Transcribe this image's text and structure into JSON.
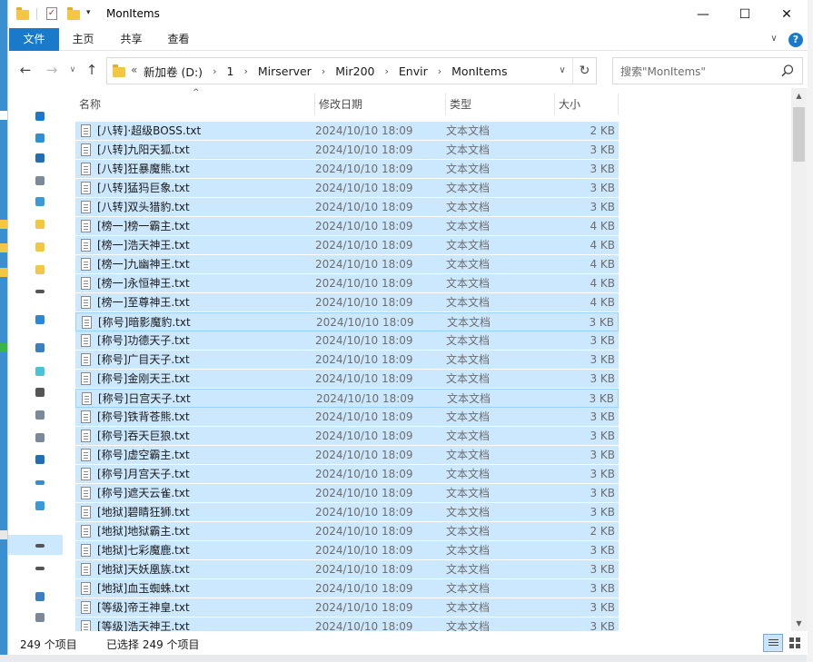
{
  "window": {
    "title": "MonItems",
    "minimize_glyph": "—",
    "maximize_glyph": "☐",
    "close_glyph": "✕"
  },
  "qat": {
    "dropdown_glyph": "▾"
  },
  "ribbon": {
    "tabs": [
      {
        "label": "文件"
      },
      {
        "label": "主页"
      },
      {
        "label": "共享"
      },
      {
        "label": "查看"
      }
    ],
    "expand_glyph": "∨",
    "help_glyph": "?"
  },
  "nav": {
    "back_glyph": "←",
    "forward_glyph": "→",
    "recent_glyph": "∨",
    "up_glyph": "↑"
  },
  "address": {
    "overflow_glyph": "«",
    "separator_glyph": "›",
    "crumbs": [
      "新加卷 (D:)",
      "1",
      "Mirserver",
      "Mir200",
      "Envir",
      "MonItems"
    ],
    "dropdown_glyph": "∨",
    "refresh_glyph": "↻"
  },
  "search": {
    "placeholder": "搜索\"MonItems\""
  },
  "columns": {
    "sort_glyph": "^",
    "name": "名称",
    "date": "修改日期",
    "type": "类型",
    "size": "大小"
  },
  "files": [
    {
      "name": "[八转]·超级BOSS.txt",
      "date": "2024/10/10 18:09",
      "type": "文本文档",
      "size": "2 KB"
    },
    {
      "name": "[八转]九阳天狐.txt",
      "date": "2024/10/10 18:09",
      "type": "文本文档",
      "size": "3 KB"
    },
    {
      "name": "[八转]狂暴魔熊.txt",
      "date": "2024/10/10 18:09",
      "type": "文本文档",
      "size": "3 KB"
    },
    {
      "name": "[八转]猛犸巨象.txt",
      "date": "2024/10/10 18:09",
      "type": "文本文档",
      "size": "3 KB"
    },
    {
      "name": "[八转]双头猎豹.txt",
      "date": "2024/10/10 18:09",
      "type": "文本文档",
      "size": "3 KB"
    },
    {
      "name": "[榜一]榜一霸主.txt",
      "date": "2024/10/10 18:09",
      "type": "文本文档",
      "size": "4 KB"
    },
    {
      "name": "[榜一]浩天神王.txt",
      "date": "2024/10/10 18:09",
      "type": "文本文档",
      "size": "4 KB"
    },
    {
      "name": "[榜一]九幽神王.txt",
      "date": "2024/10/10 18:09",
      "type": "文本文档",
      "size": "4 KB"
    },
    {
      "name": "[榜一]永恒神王.txt",
      "date": "2024/10/10 18:09",
      "type": "文本文档",
      "size": "4 KB"
    },
    {
      "name": "[榜一]至尊神王.txt",
      "date": "2024/10/10 18:09",
      "type": "文本文档",
      "size": "4 KB"
    },
    {
      "name": "[称号]暗影魔豹.txt",
      "date": "2024/10/10 18:09",
      "type": "文本文档",
      "size": "3 KB"
    },
    {
      "name": "[称号]功德天子.txt",
      "date": "2024/10/10 18:09",
      "type": "文本文档",
      "size": "3 KB"
    },
    {
      "name": "[称号]广目天子.txt",
      "date": "2024/10/10 18:09",
      "type": "文本文档",
      "size": "3 KB"
    },
    {
      "name": "[称号]金刚天王.txt",
      "date": "2024/10/10 18:09",
      "type": "文本文档",
      "size": "3 KB"
    },
    {
      "name": "[称号]日宫天子.txt",
      "date": "2024/10/10 18:09",
      "type": "文本文档",
      "size": "3 KB"
    },
    {
      "name": "[称号]铁背苍熊.txt",
      "date": "2024/10/10 18:09",
      "type": "文本文档",
      "size": "3 KB"
    },
    {
      "name": "[称号]吞天巨狼.txt",
      "date": "2024/10/10 18:09",
      "type": "文本文档",
      "size": "3 KB"
    },
    {
      "name": "[称号]虚空霸主.txt",
      "date": "2024/10/10 18:09",
      "type": "文本文档",
      "size": "3 KB"
    },
    {
      "name": "[称号]月宫天子.txt",
      "date": "2024/10/10 18:09",
      "type": "文本文档",
      "size": "3 KB"
    },
    {
      "name": "[称号]遮天云雀.txt",
      "date": "2024/10/10 18:09",
      "type": "文本文档",
      "size": "3 KB"
    },
    {
      "name": "[地狱]碧睛狂狮.txt",
      "date": "2024/10/10 18:09",
      "type": "文本文档",
      "size": "3 KB"
    },
    {
      "name": "[地狱]地狱霸主.txt",
      "date": "2024/10/10 18:09",
      "type": "文本文档",
      "size": "2 KB"
    },
    {
      "name": "[地狱]七彩魔鹿.txt",
      "date": "2024/10/10 18:09",
      "type": "文本文档",
      "size": "3 KB"
    },
    {
      "name": "[地狱]天妖凰族.txt",
      "date": "2024/10/10 18:09",
      "type": "文本文档",
      "size": "3 KB"
    },
    {
      "name": "[地狱]血玉蜘蛛.txt",
      "date": "2024/10/10 18:09",
      "type": "文本文档",
      "size": "3 KB"
    },
    {
      "name": "[等级]帝王神皇.txt",
      "date": "2024/10/10 18:09",
      "type": "文本文档",
      "size": "3 KB"
    },
    {
      "name": "[等级]浩天神王.txt",
      "date": "2024/10/10 18:09",
      "type": "文本文档",
      "size": "3 KB"
    }
  ],
  "status": {
    "item_count": "249 个项目",
    "selected_count": "已选择 249 个项目"
  },
  "scrollbar": {
    "up_glyph": "▲",
    "down_glyph": "▼"
  },
  "icons": {
    "folder": "folder-icon",
    "text_file": "text-file-icon",
    "search": "search-icon",
    "refresh": "refresh-icon"
  },
  "colors": {
    "accent": "#1979ca",
    "selection": "#cce8ff",
    "folder": "#f3c744"
  }
}
